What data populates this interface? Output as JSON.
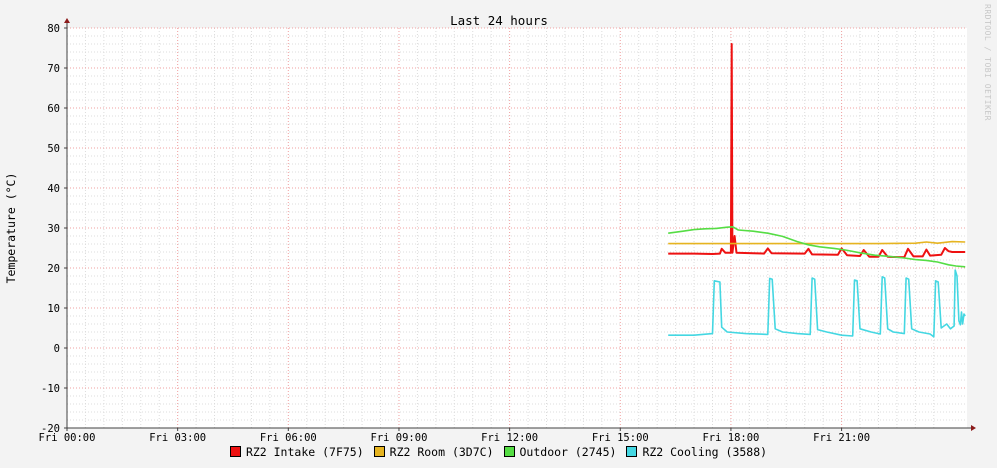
{
  "watermark": "RRDTOOL / TOBI OETIKER",
  "chart_data": {
    "type": "line",
    "title": "Last 24 hours",
    "ylabel": "Temperature (°C)",
    "xlabel": "",
    "ylim": [
      -20,
      80
    ],
    "xlim": [
      0,
      24.4
    ],
    "grid": true,
    "legend_placement": "bottom",
    "yticks": [
      80,
      70,
      60,
      50,
      40,
      30,
      20,
      10,
      0,
      -10,
      -20
    ],
    "xticks": [
      {
        "x": 0,
        "label": "Fri 00:00"
      },
      {
        "x": 3,
        "label": "Fri 03:00"
      },
      {
        "x": 6,
        "label": "Fri 06:00"
      },
      {
        "x": 9,
        "label": "Fri 09:00"
      },
      {
        "x": 12,
        "label": "Fri 12:00"
      },
      {
        "x": 15,
        "label": "Fri 15:00"
      },
      {
        "x": 18,
        "label": "Fri 18:00"
      },
      {
        "x": 21,
        "label": "Fri 21:00"
      }
    ],
    "series": [
      {
        "name": "RZ2 Intake (7F75)",
        "color": "#ee1111",
        "points": [
          [
            16.3,
            23.6
          ],
          [
            17.0,
            23.6
          ],
          [
            17.5,
            23.5
          ],
          [
            17.7,
            23.6
          ],
          [
            17.75,
            24.8
          ],
          [
            17.85,
            23.8
          ],
          [
            18.0,
            23.8
          ],
          [
            18.02,
            76
          ],
          [
            18.04,
            23.8
          ],
          [
            18.1,
            28
          ],
          [
            18.15,
            23.8
          ],
          [
            18.6,
            23.7
          ],
          [
            18.9,
            23.6
          ],
          [
            19.0,
            24.9
          ],
          [
            19.1,
            23.7
          ],
          [
            20.0,
            23.6
          ],
          [
            20.1,
            24.8
          ],
          [
            20.2,
            23.4
          ],
          [
            20.9,
            23.3
          ],
          [
            21.0,
            24.9
          ],
          [
            21.15,
            23.2
          ],
          [
            21.5,
            23.0
          ],
          [
            21.6,
            24.5
          ],
          [
            21.75,
            22.8
          ],
          [
            22.0,
            22.8
          ],
          [
            22.1,
            24.5
          ],
          [
            22.25,
            22.8
          ],
          [
            22.7,
            22.7
          ],
          [
            22.8,
            24.8
          ],
          [
            22.95,
            22.9
          ],
          [
            23.2,
            22.9
          ],
          [
            23.3,
            24.6
          ],
          [
            23.4,
            23.1
          ],
          [
            23.7,
            23.3
          ],
          [
            23.8,
            25.0
          ],
          [
            23.9,
            24.2
          ],
          [
            24.0,
            24.0
          ],
          [
            24.35,
            24.0
          ]
        ]
      },
      {
        "name": "RZ2 Room (3D7C)",
        "color": "#e6b420",
        "points": [
          [
            16.3,
            26.1
          ],
          [
            17.0,
            26.1
          ],
          [
            18.0,
            26.1
          ],
          [
            19.0,
            26.1
          ],
          [
            20.0,
            26.1
          ],
          [
            21.0,
            26.1
          ],
          [
            22.0,
            26.1
          ],
          [
            23.0,
            26.2
          ],
          [
            23.3,
            26.5
          ],
          [
            23.6,
            26.2
          ],
          [
            24.0,
            26.6
          ],
          [
            24.35,
            26.5
          ]
        ]
      },
      {
        "name": "Outdoor (2745)",
        "color": "#55dd44",
        "points": [
          [
            16.3,
            28.7
          ],
          [
            16.7,
            29.2
          ],
          [
            17.0,
            29.6
          ],
          [
            17.3,
            29.8
          ],
          [
            17.6,
            29.9
          ],
          [
            17.9,
            30.2
          ],
          [
            18.05,
            30.3
          ],
          [
            18.2,
            29.5
          ],
          [
            18.6,
            29.2
          ],
          [
            19.0,
            28.7
          ],
          [
            19.4,
            27.9
          ],
          [
            19.8,
            26.6
          ],
          [
            20.1,
            25.8
          ],
          [
            20.4,
            25.3
          ],
          [
            20.8,
            24.9
          ],
          [
            21.1,
            24.5
          ],
          [
            21.5,
            23.8
          ],
          [
            21.9,
            23.2
          ],
          [
            22.3,
            22.9
          ],
          [
            22.7,
            22.5
          ],
          [
            23.0,
            22.1
          ],
          [
            23.3,
            21.9
          ],
          [
            23.6,
            21.5
          ],
          [
            23.9,
            20.8
          ],
          [
            24.1,
            20.5
          ],
          [
            24.35,
            20.3
          ]
        ]
      },
      {
        "name": "RZ2 Cooling (3588)",
        "color": "#44d7e2",
        "points": [
          [
            16.3,
            3.2
          ],
          [
            17.0,
            3.2
          ],
          [
            17.5,
            3.6
          ],
          [
            17.55,
            16.8
          ],
          [
            17.7,
            16.5
          ],
          [
            17.75,
            5.2
          ],
          [
            17.9,
            4.0
          ],
          [
            18.4,
            3.6
          ],
          [
            19.0,
            3.4
          ],
          [
            19.05,
            17.4
          ],
          [
            19.12,
            17.2
          ],
          [
            19.2,
            4.8
          ],
          [
            19.4,
            4.0
          ],
          [
            19.8,
            3.6
          ],
          [
            20.15,
            3.4
          ],
          [
            20.2,
            17.5
          ],
          [
            20.27,
            17.2
          ],
          [
            20.35,
            4.6
          ],
          [
            20.6,
            4.0
          ],
          [
            21.0,
            3.2
          ],
          [
            21.3,
            3.0
          ],
          [
            21.35,
            17.0
          ],
          [
            21.42,
            16.8
          ],
          [
            21.5,
            4.8
          ],
          [
            21.8,
            4.0
          ],
          [
            22.05,
            3.5
          ],
          [
            22.1,
            17.8
          ],
          [
            22.17,
            17.5
          ],
          [
            22.25,
            4.8
          ],
          [
            22.4,
            4.0
          ],
          [
            22.7,
            3.6
          ],
          [
            22.75,
            17.5
          ],
          [
            22.82,
            17.2
          ],
          [
            22.9,
            4.8
          ],
          [
            23.1,
            4.0
          ],
          [
            23.4,
            3.5
          ],
          [
            23.5,
            2.8
          ],
          [
            23.55,
            16.8
          ],
          [
            23.62,
            16.5
          ],
          [
            23.7,
            5.0
          ],
          [
            23.85,
            6.0
          ],
          [
            23.95,
            4.8
          ],
          [
            24.05,
            5.5
          ],
          [
            24.08,
            19.5
          ],
          [
            24.13,
            18.0
          ],
          [
            24.18,
            6.8
          ],
          [
            24.22,
            5.8
          ],
          [
            24.25,
            9.0
          ],
          [
            24.28,
            6.0
          ],
          [
            24.32,
            8.5
          ],
          [
            24.35,
            8.0
          ]
        ]
      }
    ]
  }
}
